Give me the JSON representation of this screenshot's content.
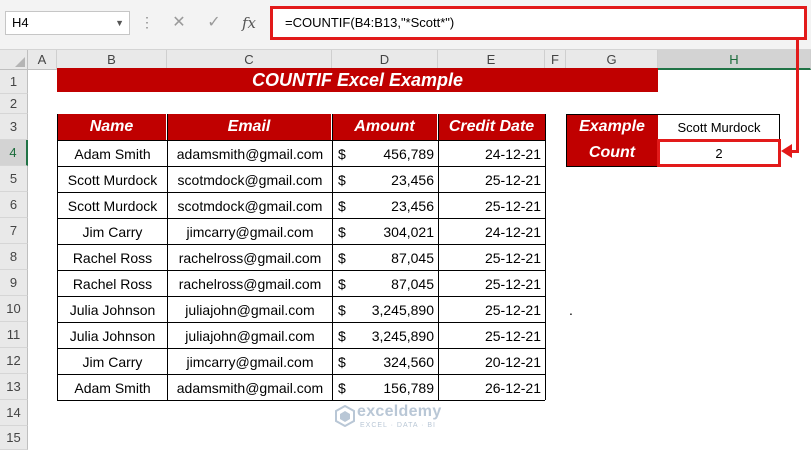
{
  "formula_bar": {
    "name_box": "H4",
    "formula": "=COUNTIF(B4:B13,\"*Scott*\")",
    "cancel_glyph": "✕",
    "enter_glyph": "✓",
    "fx_glyph": "fx"
  },
  "columns": [
    "A",
    "B",
    "C",
    "D",
    "E",
    "F",
    "G",
    "H"
  ],
  "rows": [
    "1",
    "2",
    "3",
    "4",
    "5",
    "6",
    "7",
    "8",
    "9",
    "10",
    "11",
    "12",
    "13",
    "14",
    "15"
  ],
  "selected_cell": "H4",
  "sheet": {
    "title": "COUNTIF Excel Example",
    "headers": [
      "Name",
      "Email",
      "Amount",
      "Credit Date"
    ],
    "currency_symbol": "$",
    "records": [
      {
        "name": "Adam Smith",
        "email": "adamsmith@gmail.com",
        "amount": "456,789",
        "date": "24-12-21"
      },
      {
        "name": "Scott Murdock",
        "email": "scotmdock@gmail.com",
        "amount": "23,456",
        "date": "25-12-21"
      },
      {
        "name": "Scott Murdock",
        "email": "scotmdock@gmail.com",
        "amount": "23,456",
        "date": "25-12-21"
      },
      {
        "name": "Jim Carry",
        "email": "jimcarry@gmail.com",
        "amount": "304,021",
        "date": "24-12-21"
      },
      {
        "name": "Rachel Ross",
        "email": "rachelross@gmail.com",
        "amount": "87,045",
        "date": "25-12-21"
      },
      {
        "name": "Rachel Ross",
        "email": "rachelross@gmail.com",
        "amount": "87,045",
        "date": "25-12-21"
      },
      {
        "name": "Julia Johnson",
        "email": "juliajohn@gmail.com",
        "amount": "3,245,890",
        "date": "25-12-21"
      },
      {
        "name": "Julia Johnson",
        "email": "juliajohn@gmail.com",
        "amount": "3,245,890",
        "date": "25-12-21"
      },
      {
        "name": "Jim Carry",
        "email": "jimcarry@gmail.com",
        "amount": "324,560",
        "date": "20-12-21"
      },
      {
        "name": "Adam Smith",
        "email": "adamsmith@gmail.com",
        "amount": "156,789",
        "date": "26-12-21"
      }
    ],
    "side_table": {
      "example_label": "Example",
      "example_value": "Scott Murdock",
      "count_label": "Count",
      "count_value": "2"
    },
    "stray_text": "."
  },
  "watermark": {
    "name": "exceldemy",
    "tagline": "EXCEL · DATA · BI"
  },
  "colors": {
    "header_fill": "#c00000",
    "highlight_border": "#e21a1a",
    "selection": "#217346"
  }
}
